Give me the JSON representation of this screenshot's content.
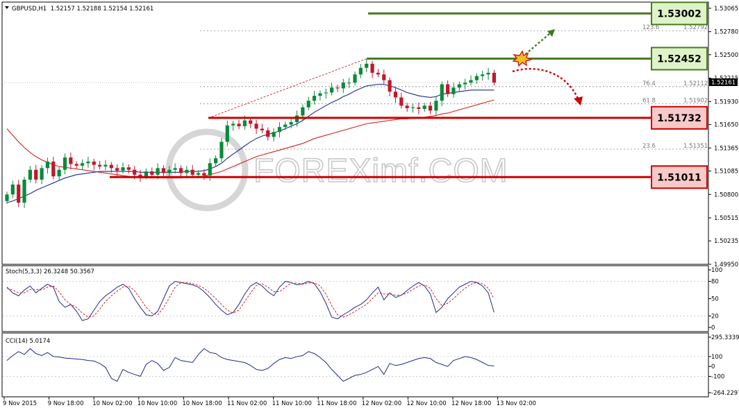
{
  "header": {
    "symbol_line": "GBPUSD,H1  1.52157 1.52188 1.52154 1.52161"
  },
  "watermark": "FOREXimf.COM",
  "colors": {
    "bull_candle": "#0a8a3a",
    "bear_candle": "#c0182b",
    "ma_fast": "#1a2a8c",
    "ma_slow": "#d42020",
    "support": "#cc0000",
    "resistance": "#4a7a20",
    "resistance_box": "#dff3c8",
    "support_box": "#f7c9c9",
    "indicator_line": "#1a2a8c",
    "signal_line": "#e02020"
  },
  "chart_data": [
    {
      "type": "candlestick",
      "pane": "price",
      "title": "GBPUSD,H1  1.52157 1.52188 1.52154 1.52161",
      "ylim": [
        1.4995,
        1.5314
      ],
      "y_ticks": [
        "1.53065",
        "1.52780",
        "1.52500",
        "1.52215",
        "1.51930",
        "1.51650",
        "1.51365",
        "1.51085",
        "1.50800",
        "1.50515",
        "1.50235",
        "1.49950"
      ],
      "current_price": "1.52161",
      "series": [
        {
          "close": [
            1.508,
            1.5092,
            1.507,
            1.5098,
            1.511,
            1.5098,
            1.5112,
            1.512,
            1.5102,
            1.511,
            1.5125,
            1.5117,
            1.5115,
            1.5118,
            1.512,
            1.5116,
            1.5114,
            1.5116,
            1.5112,
            1.5109,
            1.5113,
            1.511,
            1.5104,
            1.5102,
            1.5108,
            1.5104,
            1.5112,
            1.5106,
            1.511,
            1.5112,
            1.5106,
            1.511,
            1.5104,
            1.5106,
            1.5103,
            1.5118,
            1.5124,
            1.5144,
            1.5164,
            1.5166,
            1.5163,
            1.517,
            1.5166,
            1.516,
            1.5158,
            1.515,
            1.5156,
            1.5162,
            1.5165,
            1.5168,
            1.5176,
            1.5186,
            1.5194,
            1.52,
            1.5203,
            1.5204,
            1.521,
            1.5209,
            1.5216,
            1.5216,
            1.5226,
            1.5234,
            1.5239,
            1.5228,
            1.5226,
            1.5219,
            1.5205,
            1.5198,
            1.5188,
            1.5185,
            1.5186,
            1.5184,
            1.5188,
            1.5182,
            1.5194,
            1.5214,
            1.5202,
            1.521,
            1.5214,
            1.5216,
            1.5219,
            1.5224,
            1.5226,
            1.5228,
            1.5216
          ]
        }
      ]
    },
    {
      "type": "line",
      "pane": "price",
      "name": "moving averages",
      "series": [
        {
          "x": [
            0,
            1,
            2,
            3,
            4,
            5,
            6,
            7,
            8,
            9,
            10,
            11,
            12,
            13,
            14,
            15,
            16,
            17,
            18,
            19,
            20,
            21,
            22,
            23,
            24,
            25,
            26,
            27,
            28,
            29,
            30,
            31,
            32,
            33,
            34,
            35,
            36,
            37,
            38,
            39,
            40,
            41,
            42,
            43,
            44,
            45,
            46,
            47,
            48,
            49,
            50,
            51,
            52,
            53,
            54,
            55,
            56,
            57,
            58,
            59,
            60,
            61,
            62,
            63,
            64,
            65,
            66,
            67,
            68,
            69,
            70,
            71,
            72,
            73,
            74,
            75,
            76,
            77,
            78,
            79,
            80,
            81,
            82,
            83,
            84
          ],
          "values": [
            1.507,
            1.5072,
            1.5075,
            1.5078,
            1.5081,
            1.5085,
            1.5088,
            1.5091,
            1.5094,
            1.5097,
            1.51,
            1.5102,
            1.5104,
            1.5105,
            1.5106,
            1.5107,
            1.5108,
            1.5108,
            1.5108,
            1.5108,
            1.5108,
            1.5108,
            1.5108,
            1.5107,
            1.5107,
            1.5107,
            1.5107,
            1.5107,
            1.5107,
            1.5107,
            1.5107,
            1.5108,
            1.5108,
            1.5108,
            1.5109,
            1.5111,
            1.5114,
            1.5118,
            1.5124,
            1.5129,
            1.5134,
            1.5139,
            1.5144,
            1.5148,
            1.5151,
            1.5153,
            1.5155,
            1.5157,
            1.516,
            1.5163,
            1.5166,
            1.517,
            1.5175,
            1.518,
            1.5184,
            1.5188,
            1.5192,
            1.5195,
            1.5199,
            1.5202,
            1.5206,
            1.5209,
            1.5212,
            1.5213,
            1.5214,
            1.5214,
            1.5212,
            1.521,
            1.5207,
            1.5204,
            1.5202,
            1.52,
            1.5199,
            1.5198,
            1.5199,
            1.5202,
            1.5203,
            1.5204,
            1.5205,
            1.5206,
            1.5207,
            1.5207,
            1.5207,
            1.5207,
            1.5207
          ]
        },
        {
          "x": [
            0,
            1,
            2,
            3,
            4,
            5,
            6,
            7,
            8,
            9,
            10,
            11,
            12,
            13,
            14,
            15,
            16,
            17,
            18,
            19,
            20,
            21,
            22,
            23,
            24,
            25,
            26,
            27,
            28,
            29,
            30,
            31,
            32,
            33,
            34,
            35,
            36,
            37,
            38,
            39,
            40,
            41,
            42,
            43,
            44,
            45,
            46,
            47,
            48,
            49,
            50,
            51,
            52,
            53,
            54,
            55,
            56,
            57,
            58,
            59,
            60,
            61,
            62,
            63,
            64,
            65,
            66,
            67,
            68,
            69,
            70,
            71,
            72,
            73,
            74,
            75,
            76,
            77,
            78,
            79,
            80,
            81,
            82,
            83,
            84
          ],
          "values": [
            1.516,
            1.5152,
            1.5144,
            1.5137,
            1.5131,
            1.5126,
            1.5122,
            1.5119,
            1.5116,
            1.5114,
            1.5113,
            1.5112,
            1.5111,
            1.511,
            1.5109,
            1.5108,
            1.5107,
            1.5106,
            1.5105,
            1.5104,
            1.5103,
            1.5102,
            1.5101,
            1.51,
            1.51,
            1.51,
            1.51,
            1.51,
            1.51,
            1.51,
            1.51,
            1.5101,
            1.5101,
            1.5102,
            1.5102,
            1.5104,
            1.5106,
            1.5108,
            1.5111,
            1.5114,
            1.5117,
            1.512,
            1.5123,
            1.5126,
            1.5128,
            1.513,
            1.5132,
            1.5134,
            1.5136,
            1.5138,
            1.514,
            1.5142,
            1.5145,
            1.5148,
            1.515,
            1.5152,
            1.5154,
            1.5156,
            1.5158,
            1.516,
            1.5162,
            1.5164,
            1.5166,
            1.5167,
            1.5168,
            1.5169,
            1.517,
            1.5171,
            1.5172,
            1.5172,
            1.5173,
            1.5173,
            1.5174,
            1.5175,
            1.5176,
            1.5178,
            1.5179,
            1.5181,
            1.5183,
            1.5185,
            1.5187,
            1.5189,
            1.5191,
            1.5193,
            1.5195
          ]
        }
      ]
    },
    {
      "type": "levels",
      "pane": "price",
      "resistance": [
        "1.53002",
        "1.52452"
      ],
      "support": [
        "1.51732",
        "1.51011"
      ],
      "fibonacci": [
        {
          "ratio": "123.6",
          "price": "1.52792"
        },
        {
          "ratio": "76.4",
          "price": "1.52112"
        },
        {
          "ratio": "61.8",
          "price": "1.51902"
        },
        {
          "ratio": "23.6",
          "price": "1.51351"
        }
      ]
    },
    {
      "type": "line",
      "pane": "stochastic",
      "title": "Stoch(5,3,3) 26.3248 50.3567",
      "ylim": [
        0,
        100
      ],
      "y_ticks": [
        "100",
        "80",
        "50",
        "20",
        "0"
      ],
      "series": [
        {
          "values": [
            70,
            60,
            55,
            65,
            72,
            60,
            68,
            75,
            70,
            45,
            35,
            40,
            28,
            12,
            15,
            30,
            45,
            55,
            62,
            70,
            75,
            68,
            50,
            35,
            22,
            20,
            28,
            50,
            72,
            80,
            78,
            76,
            74,
            70,
            62,
            52,
            40,
            30,
            22,
            26,
            40,
            58,
            72,
            78,
            72,
            62,
            55,
            70,
            80,
            78,
            74,
            76,
            80,
            76,
            62,
            42,
            18,
            15,
            22,
            28,
            35,
            40,
            48,
            60,
            70,
            48,
            60,
            52,
            56,
            64,
            72,
            78,
            72,
            58,
            26,
            35,
            50,
            60,
            70,
            75,
            80,
            78,
            72,
            60,
            26
          ]
        },
        {
          "values": [
            68,
            65,
            60,
            60,
            66,
            66,
            65,
            70,
            72,
            62,
            48,
            40,
            35,
            25,
            18,
            20,
            32,
            45,
            55,
            63,
            70,
            72,
            64,
            50,
            35,
            25,
            22,
            34,
            52,
            70,
            78,
            78,
            76,
            73,
            68,
            60,
            50,
            40,
            30,
            25,
            30,
            45,
            60,
            73,
            76,
            70,
            62,
            62,
            70,
            77,
            77,
            75,
            77,
            78,
            72,
            58,
            38,
            22,
            18,
            22,
            28,
            34,
            40,
            50,
            60,
            58,
            58,
            56,
            56,
            60,
            66,
            72,
            74,
            68,
            50,
            38,
            42,
            50,
            60,
            68,
            75,
            78,
            76,
            68,
            50
          ]
        }
      ]
    },
    {
      "type": "line",
      "pane": "cci",
      "title": "CCI(14) 5.0174",
      "ylim": [
        -264.2297,
        295.3339
      ],
      "y_ticks": [
        "295.3339",
        "100",
        "0",
        "-100",
        "-264.2297"
      ],
      "series": [
        {
          "values": [
            60,
            110,
            150,
            120,
            180,
            130,
            110,
            140,
            100,
            95,
            85,
            80,
            75,
            70,
            60,
            55,
            30,
            -10,
            -120,
            -150,
            -30,
            -60,
            -80,
            -100,
            20,
            60,
            30,
            -40,
            -10,
            90,
            60,
            50,
            40,
            120,
            180,
            140,
            130,
            90,
            70,
            60,
            50,
            40,
            10,
            -30,
            -40,
            -20,
            30,
            70,
            90,
            80,
            100,
            110,
            150,
            130,
            90,
            40,
            -30,
            -90,
            -150,
            -120,
            -90,
            -80,
            -60,
            -30,
            0,
            -80,
            30,
            10,
            20,
            40,
            60,
            80,
            90,
            80,
            40,
            20,
            0,
            60,
            80,
            100,
            90,
            70,
            40,
            10,
            5
          ]
        }
      ]
    },
    {
      "type": "axis",
      "x_labels": [
        "9 Nov 2015",
        "9 Nov 18:00",
        "10 Nov 02:00",
        "10 Nov 10:00",
        "10 Nov 18:00",
        "11 Nov 02:00",
        "11 Nov 10:00",
        "11 Nov 18:00",
        "12 Nov 02:00",
        "12 Nov 10:00",
        "12 Nov 18:00",
        "13 Nov 02:00"
      ]
    }
  ]
}
